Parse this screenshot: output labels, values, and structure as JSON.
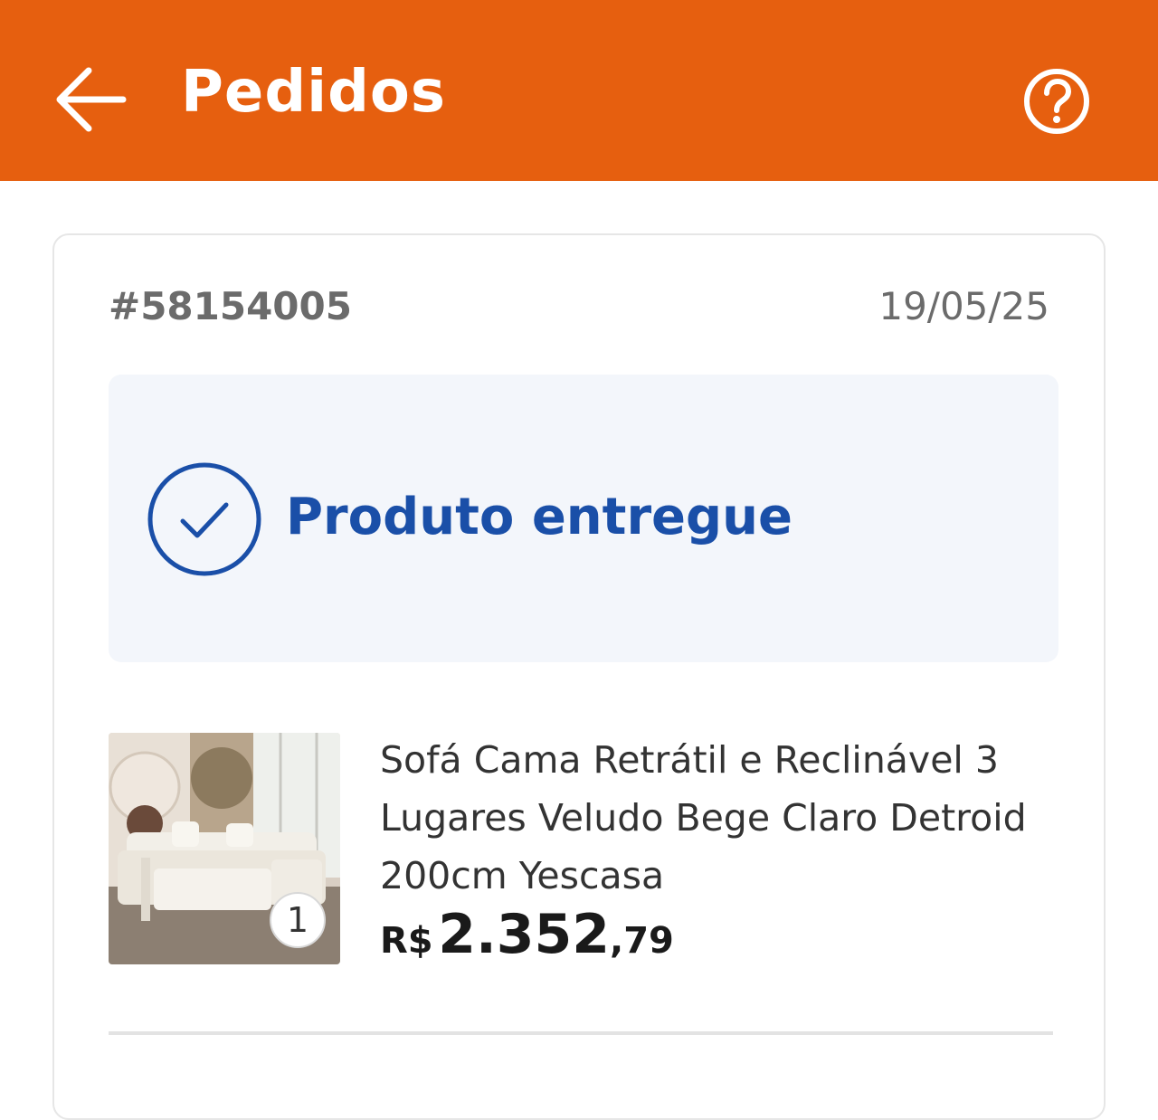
{
  "header": {
    "title": "Pedidos",
    "back_icon": "arrow-left-icon",
    "help_icon": "question-circle-icon",
    "background_color": "#e65f0f"
  },
  "order": {
    "id": "#58154005",
    "date": "19/05/25",
    "status": {
      "text": "Produto entregue",
      "icon": "check-circle-icon",
      "color": "#1a4fa8"
    },
    "items": [
      {
        "name": "Sofá Cama Retrátil e Reclinável 3 Lugares Veludo Bege Claro Detroid 200cm Yescasa",
        "quantity": "1",
        "price_currency": "R$",
        "price_integer": "2.352",
        "price_decimal": ",79"
      }
    ]
  }
}
